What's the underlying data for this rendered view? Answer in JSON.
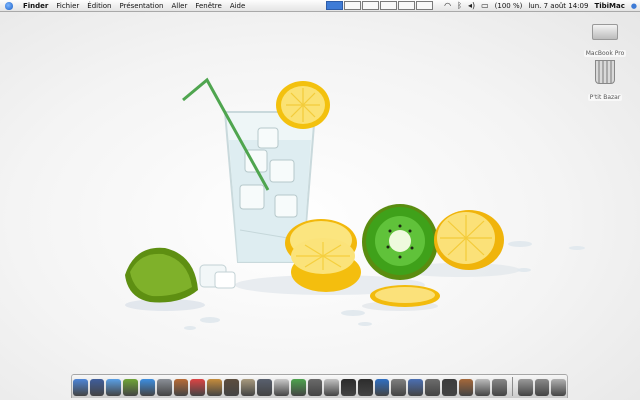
{
  "menubar": {
    "apple": "apple-icon",
    "items": [
      "Finder",
      "Fichier",
      "Édition",
      "Présentation",
      "Aller",
      "Fenêtre",
      "Aide"
    ],
    "battery": "(100 %)",
    "clock": "lun. 7 août 14:09",
    "user": "TibiMac"
  },
  "desktop": {
    "icons": [
      {
        "label": "MacBook Pro",
        "icon": "hard-drive-icon"
      },
      {
        "label": "P'tit Bazar",
        "icon": "trash-icon"
      }
    ]
  },
  "dock": {
    "apps": [
      {
        "icon": "finder-icon",
        "color": "#4e86d8"
      },
      {
        "icon": "dashboard-icon",
        "color": "#3f5e9c"
      },
      {
        "icon": "ichat-icon",
        "color": "#5aa0e6"
      },
      {
        "icon": "adium-icon",
        "color": "#6fa537"
      },
      {
        "icon": "safari-icon",
        "color": "#3d8ee0"
      },
      {
        "icon": "mail-icon",
        "color": "#8a8f97"
      },
      {
        "icon": "address-book-icon",
        "color": "#b86b35"
      },
      {
        "icon": "ical-icon",
        "color": "#d44"
      },
      {
        "icon": "notes-icon",
        "color": "#c58c3c"
      },
      {
        "icon": "dictionary-icon",
        "color": "#5d4e3f"
      },
      {
        "icon": "preview-icon",
        "color": "#a89a7e"
      },
      {
        "icon": "text-editor-icon",
        "color": "#59606e"
      },
      {
        "icon": "photo-icon",
        "color": "#c9c9c9"
      },
      {
        "icon": "itunes-icon",
        "color": "#4da34d"
      },
      {
        "icon": "iphoto-icon",
        "color": "#6a6a6a"
      },
      {
        "icon": "imovie-icon",
        "color": "#c2c2c2"
      },
      {
        "icon": "quicktime-icon",
        "color": "#2b2b2b"
      },
      {
        "icon": "dvd-player-icon",
        "color": "#2d2d2d"
      },
      {
        "icon": "itunes-music-icon",
        "color": "#2f6fc3"
      },
      {
        "icon": "system-preferences-icon",
        "color": "#7f7f7f"
      },
      {
        "icon": "activity-monitor-icon",
        "color": "#4b6fb3"
      },
      {
        "icon": "terminal-icon",
        "color": "#6c6c6c"
      },
      {
        "icon": "network-icon",
        "color": "#3c3c3c"
      },
      {
        "icon": "utilities-icon",
        "color": "#a5683a"
      },
      {
        "icon": "apple-store-icon",
        "color": "#bbbbbb"
      },
      {
        "icon": "tools-icon",
        "color": "#888888"
      }
    ],
    "stacks": [
      {
        "icon": "applications-stack-icon",
        "color": "#9a9a9a"
      },
      {
        "icon": "utilities-stack-icon",
        "color": "#8a8a8a"
      },
      {
        "icon": "trash-icon",
        "color": "#b0b0b0"
      }
    ]
  }
}
